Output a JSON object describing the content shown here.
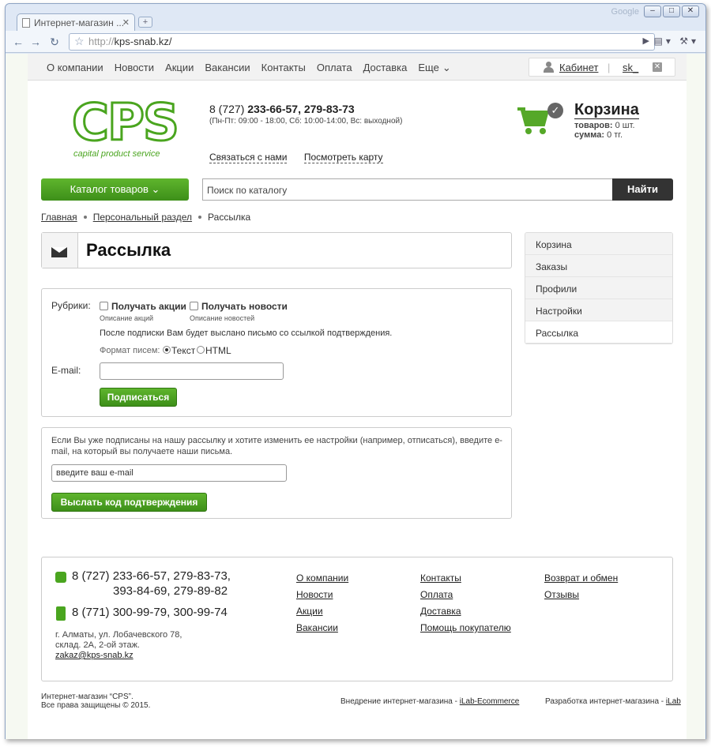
{
  "browser": {
    "tab_title": "Интернет-магазин ...",
    "brand": "Google",
    "url_proto": "http://",
    "url_host": "kps-snab.kz/"
  },
  "topnav": {
    "items": [
      "О компании",
      "Новости",
      "Акции",
      "Вакансии",
      "Контакты",
      "Оплата",
      "Доставка",
      "Еще"
    ],
    "cabinet": "Кабинет",
    "user": "sk_"
  },
  "header": {
    "logo_text": "CPS",
    "logo_tagline": "capital product service",
    "phone_prefix": "8 (727) ",
    "phone_numbers": "233-66-57, 279-83-73",
    "hours": "(Пн-Пт: 09:00 - 18:00,  Сб: 10:00-14:00, Вс: выходной)",
    "contact_link": "Связаться с нами",
    "map_link": "Посмотреть карту",
    "cart_title": "Корзина",
    "cart_items_label": "товаров:",
    "cart_items_value": "0 шт.",
    "cart_sum_label": "сумма:",
    "cart_sum_value": "0 тг."
  },
  "catalog": {
    "button": "Каталог товаров",
    "search_placeholder": "Поиск по каталогу",
    "find": "Найти"
  },
  "breadcrumb": [
    "Главная",
    "Персональный раздел",
    "Рассылка"
  ],
  "page_title": "Рассылка",
  "sidebar": [
    "Корзина",
    "Заказы",
    "Профили",
    "Настройки",
    "Рассылка"
  ],
  "subscribe": {
    "rubrics_label": "Рубрики:",
    "opt1": "Получать акции",
    "opt1_desc": "Описание акций",
    "opt2": "Получать новости",
    "opt2_desc": "Описание новостей",
    "notice": "После подписки Вам будет выслано письмо со ссылкой подтверждения.",
    "format_label": "Формат писем:",
    "format_text": "Текст",
    "format_html": "HTML",
    "email_label": "E-mail:",
    "email_value": "",
    "submit": "Подписаться"
  },
  "resend": {
    "text": "Если Вы уже подписаны на нашу рассылку и хотите изменить ее настройки (например, отписаться), введите e-mail, на который вы получаете наши письма.",
    "placeholder": "введите ваш e-mail",
    "button": "Выслать код подтверждения"
  },
  "footer": {
    "phone1_a": "8 (727) 233-66-57, 279-83-73,",
    "phone1_b": "393-84-69, 279-89-82",
    "phone2": "8 (771) 300-99-79, 300-99-74",
    "addr1": "г. Алматы, ул. Лобачевского 78,",
    "addr2": "склад. 2А, 2-ой этаж.",
    "email": "zakaz@kps-snab.kz",
    "col1": [
      "О компании",
      "Новости",
      "Акции",
      "Вакансии"
    ],
    "col2": [
      "Контакты",
      "Оплата",
      "Доставка",
      "Помощь покупателю"
    ],
    "col3": [
      "Возврат и обмен",
      "Отзывы"
    ],
    "copy1": "Интернет-магазин “CPS”.",
    "copy2": "Все права защищены © 2015.",
    "impl_text": "Внедрение интернет-магазина - ",
    "impl_link": "iLab-Ecommerce",
    "dev_text": "Разработка интернет-магазина - ",
    "dev_link": "iLab"
  },
  "colors": {
    "accent": "#4aa51f",
    "dark_button": "#333333"
  }
}
